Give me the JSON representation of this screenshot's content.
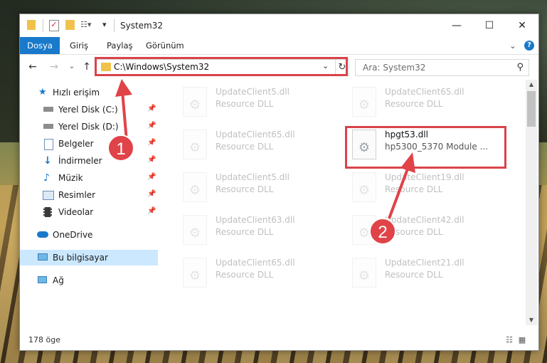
{
  "window": {
    "title": "System32"
  },
  "ribbon": {
    "tabs": [
      "Dosya",
      "Giriş",
      "Paylaş",
      "Görünüm"
    ]
  },
  "address": {
    "path": "C:\\Windows\\System32"
  },
  "search": {
    "placeholder": "Ara: System32"
  },
  "sidebar": {
    "items": [
      {
        "label": "Hızlı erişim",
        "icon": "star-icon"
      },
      {
        "label": "Yerel Disk (C:)",
        "icon": "drive-icon",
        "pinned": true
      },
      {
        "label": "Yerel Disk (D:)",
        "icon": "drive-icon",
        "pinned": true
      },
      {
        "label": "Belgeler",
        "icon": "documents-icon",
        "pinned": true
      },
      {
        "label": "İndirmeler",
        "icon": "download-icon",
        "pinned": true
      },
      {
        "label": "Müzik",
        "icon": "music-icon",
        "pinned": true
      },
      {
        "label": "Resimler",
        "icon": "pictures-icon",
        "pinned": true
      },
      {
        "label": "Videolar",
        "icon": "video-icon",
        "pinned": true
      },
      {
        "label": "OneDrive",
        "icon": "cloud-icon"
      },
      {
        "label": "Bu bilgisayar",
        "icon": "computer-icon",
        "selected": true
      },
      {
        "label": "Ağ",
        "icon": "network-icon"
      }
    ]
  },
  "files": [
    {
      "name": "UpdateClient5.dll",
      "desc": "Resource DLL",
      "faded": true
    },
    {
      "name": "UpdateClient65.dll",
      "desc": "Resource DLL",
      "faded": true
    },
    {
      "name": "UpdateClient65.dll",
      "desc": "Resource DLL",
      "faded": true
    },
    {
      "name": "hpgt53.dll",
      "desc": "hp5300_5370 Module ...",
      "faded": false
    },
    {
      "name": "UpdateClient5.dll",
      "desc": "Resource DLL",
      "faded": true
    },
    {
      "name": "UpdateClient19.dll",
      "desc": "Resource DLL",
      "faded": true
    },
    {
      "name": "UpdateClient63.dll",
      "desc": "Resource DLL",
      "faded": true
    },
    {
      "name": "UpdateClient42.dll",
      "desc": "Resource DLL",
      "faded": true
    },
    {
      "name": "UpdateClient65.dll",
      "desc": "Resource DLL",
      "faded": true
    },
    {
      "name": "UpdateClient21.dll",
      "desc": "Resource DLL",
      "faded": true
    }
  ],
  "status": {
    "count": "178 öge"
  },
  "annotations": {
    "step1": "1",
    "step2": "2",
    "color": "#d9434a"
  }
}
